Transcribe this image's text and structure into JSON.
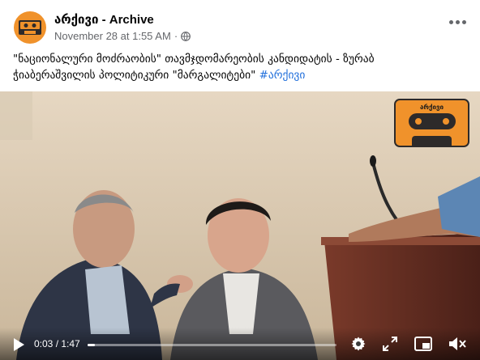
{
  "post": {
    "page_name": "არქივი - Archive",
    "timestamp": "November 28 at 1:55 AM",
    "separator": "·",
    "privacy_icon": "globe-icon",
    "text_line1": "\"ნაციონალური მოძრაობის\" თავმჯდომარეობის კანდიდატის -  ზურაბ",
    "text_line2": "ჭიაბერაშვილის პოლიტიკური \"მარგალიტები\" ",
    "hashtag": "#არქივი"
  },
  "video": {
    "watermark_text": "არქივი",
    "current_time": "0:03",
    "duration": "1:47",
    "time_separator": " / ",
    "progress": 0.03,
    "controls": [
      "play-icon",
      "settings-icon",
      "fullscreen-icon",
      "pip-icon",
      "mute-icon"
    ]
  },
  "colors": {
    "brand": "#f0922b",
    "hashtag": "#216fdb",
    "meta": "#65676b"
  }
}
